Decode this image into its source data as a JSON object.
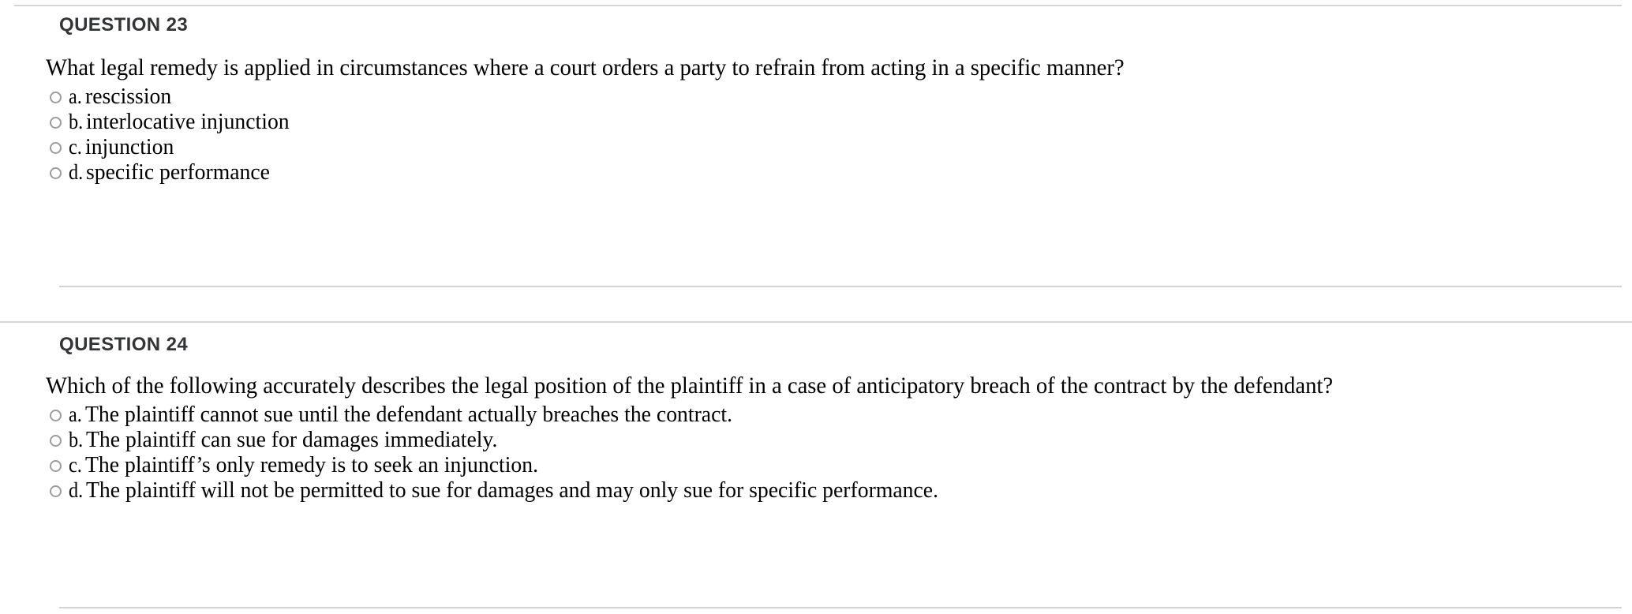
{
  "questions": [
    {
      "heading": "QUESTION 23",
      "text": "What legal remedy is applied in circumstances where a court orders a party to refrain from acting in a specific manner?",
      "options": [
        {
          "letter": "a.",
          "text": "rescission"
        },
        {
          "letter": "b.",
          "text": "interlocative injunction"
        },
        {
          "letter": "c.",
          "text": "injunction"
        },
        {
          "letter": "d.",
          "text": "specific performance"
        }
      ]
    },
    {
      "heading": "QUESTION 24",
      "text": "Which of the following accurately describes the legal position of the plaintiff in a case of anticipatory breach of the contract by the defendant?",
      "options": [
        {
          "letter": "a.",
          "text": "The plaintiff cannot sue until the defendant actually breaches the contract."
        },
        {
          "letter": "b.",
          "text": "The plaintiff can sue for damages immediately."
        },
        {
          "letter": "c.",
          "text": "The plaintiff’s only remedy is to seek an injunction."
        },
        {
          "letter": "d.",
          "text": "The plaintiff will not be permitted to sue for damages and may only sue for specific performance."
        }
      ]
    }
  ],
  "colors": {
    "divider": "#d2d4d6",
    "heading": "#333436",
    "text": "#000000",
    "radio_border": "#9a9c9e",
    "background": "#ffffff"
  }
}
